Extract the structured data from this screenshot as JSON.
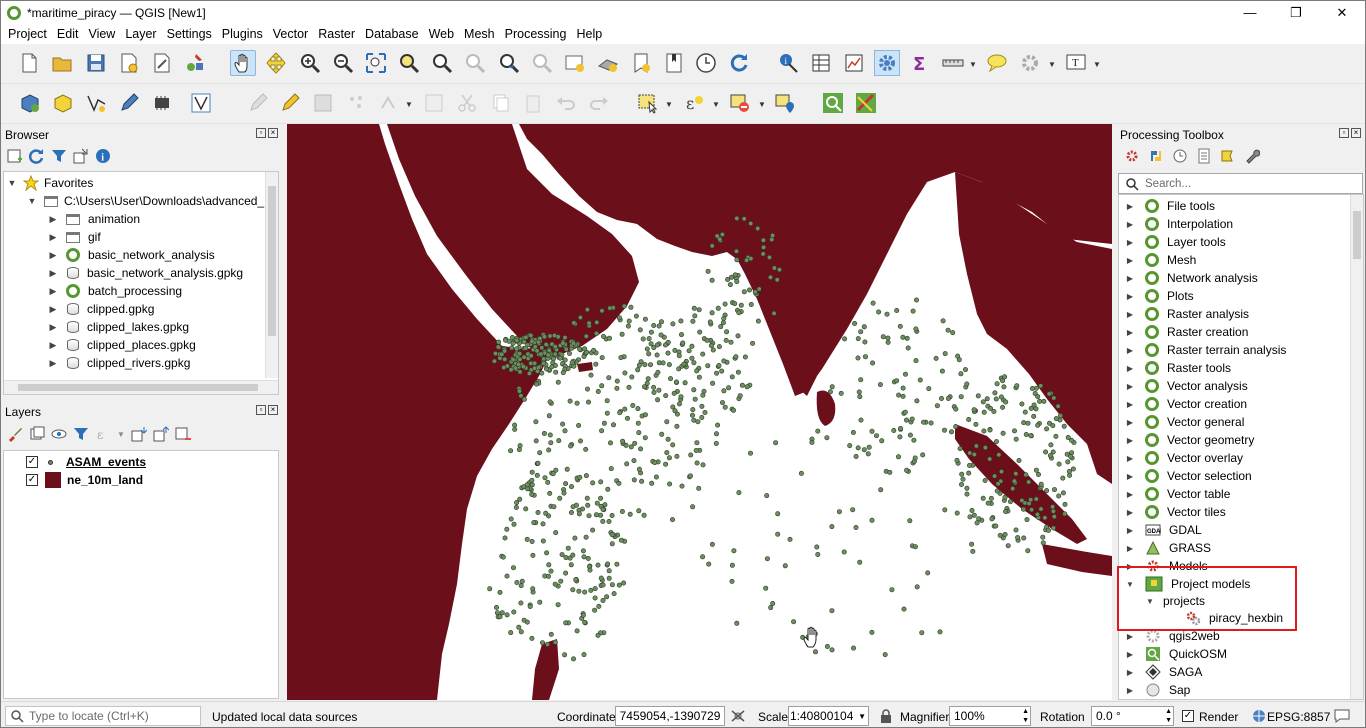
{
  "window": {
    "title": "*maritime_piracy — QGIS [New1]",
    "minimize": "—",
    "maximize": "❐",
    "close": "✕"
  },
  "menu": [
    "Project",
    "Edit",
    "View",
    "Layer",
    "Settings",
    "Plugins",
    "Vector",
    "Raster",
    "Database",
    "Web",
    "Mesh",
    "Processing",
    "Help"
  ],
  "browser": {
    "title": "Browser",
    "items": [
      {
        "label": "Favorites",
        "icon": "star-icon"
      },
      {
        "label": "C:\\Users\\User\\Downloads\\advanced_",
        "icon": "folder-icon"
      },
      {
        "label": "animation",
        "icon": "folder-icon"
      },
      {
        "label": "gif",
        "icon": "folder-icon"
      },
      {
        "label": "basic_network_analysis",
        "icon": "qgis-project-icon"
      },
      {
        "label": "basic_network_analysis.gpkg",
        "icon": "geopackage-icon"
      },
      {
        "label": "batch_processing",
        "icon": "qgis-project-icon"
      },
      {
        "label": "clipped.gpkg",
        "icon": "geopackage-icon"
      },
      {
        "label": "clipped_lakes.gpkg",
        "icon": "geopackage-icon"
      },
      {
        "label": "clipped_places.gpkg",
        "icon": "geopackage-icon"
      },
      {
        "label": "clipped_rivers.gpkg",
        "icon": "geopackage-icon"
      }
    ]
  },
  "layers": {
    "title": "Layers",
    "items": [
      {
        "label": "ASAM_events",
        "checked": true,
        "symbol_color": "#6b8f5e"
      },
      {
        "label": "ne_10m_land",
        "checked": true,
        "symbol_color": "#6b0f1a"
      }
    ]
  },
  "map": {
    "land_color": "#6b0f1a",
    "point_color": "#6b8f5e",
    "water_color": "#ffffff"
  },
  "processing": {
    "title": "Processing Toolbox",
    "search_placeholder": "Search...",
    "items": [
      {
        "label": "File tools",
        "icon": "qgis-icon"
      },
      {
        "label": "Interpolation",
        "icon": "qgis-icon"
      },
      {
        "label": "Layer tools",
        "icon": "qgis-icon"
      },
      {
        "label": "Mesh",
        "icon": "qgis-icon"
      },
      {
        "label": "Network analysis",
        "icon": "qgis-icon"
      },
      {
        "label": "Plots",
        "icon": "qgis-icon"
      },
      {
        "label": "Raster analysis",
        "icon": "qgis-icon"
      },
      {
        "label": "Raster creation",
        "icon": "qgis-icon"
      },
      {
        "label": "Raster terrain analysis",
        "icon": "qgis-icon"
      },
      {
        "label": "Raster tools",
        "icon": "qgis-icon"
      },
      {
        "label": "Vector analysis",
        "icon": "qgis-icon"
      },
      {
        "label": "Vector creation",
        "icon": "qgis-icon"
      },
      {
        "label": "Vector general",
        "icon": "qgis-icon"
      },
      {
        "label": "Vector geometry",
        "icon": "qgis-icon"
      },
      {
        "label": "Vector overlay",
        "icon": "qgis-icon"
      },
      {
        "label": "Vector selection",
        "icon": "qgis-icon"
      },
      {
        "label": "Vector table",
        "icon": "qgis-icon"
      },
      {
        "label": "Vector tiles",
        "icon": "qgis-icon"
      },
      {
        "label": "GDAL",
        "icon": "gdal-icon"
      },
      {
        "label": "GRASS",
        "icon": "grass-icon"
      },
      {
        "label": "Models",
        "icon": "models-icon"
      },
      {
        "label": "Project models",
        "icon": "project-models-icon"
      },
      {
        "label": "projects",
        "icon": "none"
      },
      {
        "label": "piracy_hexbin",
        "icon": "model-gear-icon"
      },
      {
        "label": "qgis2web",
        "icon": "qgis2web-icon"
      },
      {
        "label": "QuickOSM",
        "icon": "quickosm-icon"
      },
      {
        "label": "SAGA",
        "icon": "saga-icon"
      },
      {
        "label": "Sap",
        "icon": "sap-icon"
      }
    ]
  },
  "status": {
    "locate_placeholder": "Type to locate (Ctrl+K)",
    "message": "Updated local data sources",
    "coordinate_label": "Coordinate",
    "coordinate_value": "7459054,-1390729",
    "scale_label": "Scale",
    "scale_value": "1:40800104",
    "magnifier_label": "Magnifier",
    "magnifier_value": "100%",
    "rotation_label": "Rotation",
    "rotation_value": "0.0 °",
    "render_label": "Render",
    "crs_label": "EPSG:8857"
  }
}
